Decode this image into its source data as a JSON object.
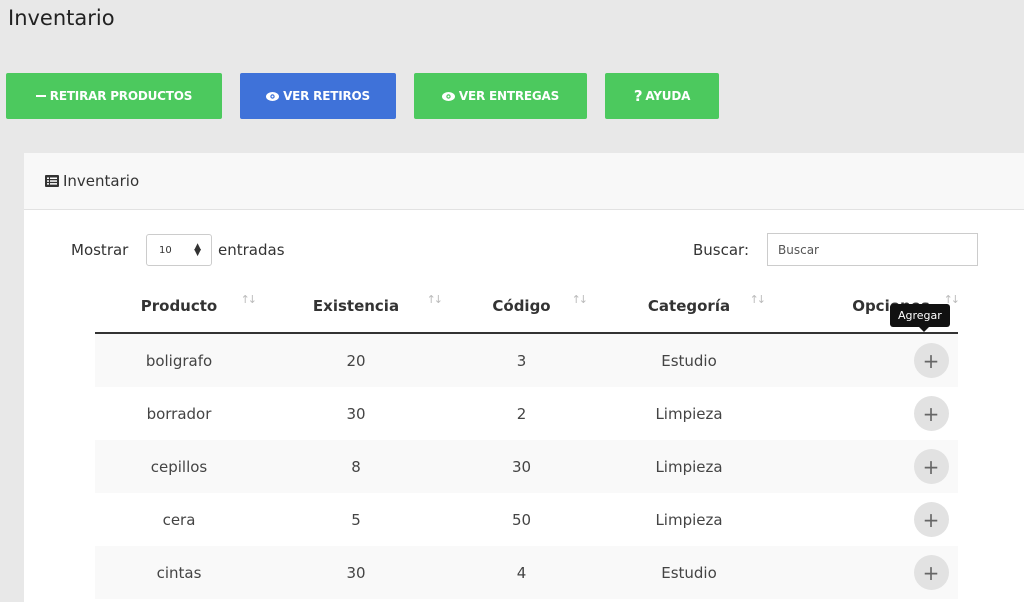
{
  "page": {
    "title": "Inventario"
  },
  "toolbar": {
    "retirar": {
      "label": "RETIRAR PRODUCTOS",
      "icon": "minus-icon"
    },
    "ver_retiros": {
      "label": "VER RETIROS",
      "icon": "eye-icon"
    },
    "ver_entregas": {
      "label": "VER ENTREGAS",
      "icon": "eye-icon"
    },
    "ayuda": {
      "label": "AYUDA",
      "icon": "question-icon"
    }
  },
  "card": {
    "title": "Inventario",
    "icon": "list-icon"
  },
  "length": {
    "label": "Mostrar",
    "value": "10",
    "after": "entradas"
  },
  "search": {
    "label": "Buscar:",
    "placeholder": "Buscar"
  },
  "table": {
    "headers": [
      "Producto",
      "Existencia",
      "Código",
      "Categoría",
      "Opciones"
    ],
    "rows": [
      {
        "producto": "boligrafo",
        "existencia": "20",
        "codigo": "3",
        "categoria": "Estudio",
        "action": "+"
      },
      {
        "producto": "borrador",
        "existencia": "30",
        "codigo": "2",
        "categoria": "Limpieza",
        "action": "+"
      },
      {
        "producto": "cepillos",
        "existencia": "8",
        "codigo": "30",
        "categoria": "Limpieza",
        "action": "+"
      },
      {
        "producto": "cera",
        "existencia": "5",
        "codigo": "50",
        "categoria": "Limpieza",
        "action": "+"
      },
      {
        "producto": "cintas",
        "existencia": "30",
        "codigo": "4",
        "categoria": "Estudio",
        "action": "+"
      }
    ]
  },
  "tooltip": {
    "text": "Agregar"
  },
  "colors": {
    "green": "#4cc95e",
    "blue": "#3f72d9"
  }
}
